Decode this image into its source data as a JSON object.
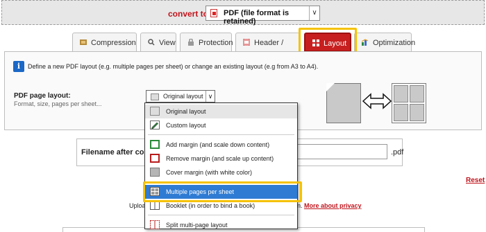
{
  "header": {
    "convert_label": "convert to:",
    "format_value": "PDF (file format is retained)"
  },
  "tabs": [
    {
      "label": "Compression",
      "icon": "compression-icon",
      "active": false
    },
    {
      "label": "View",
      "icon": "view-icon",
      "active": false
    },
    {
      "label": "Protection",
      "icon": "lock-icon",
      "active": false
    },
    {
      "label": "Header / footer",
      "icon": "header-footer-icon",
      "active": false
    },
    {
      "label": "Layout",
      "icon": "layout-icon",
      "active": true
    },
    {
      "label": "Optimization",
      "icon": "optimization-icon",
      "active": false
    }
  ],
  "panel": {
    "info_text": "Define a new PDF layout (e.g. multiple pages per sheet) or change an existing layout (e.g from A3 to A4).",
    "layout_label": "PDF page layout:",
    "layout_sub": "Format, size, pages per sheet...",
    "layout_select_value": "Original layout"
  },
  "dropdown": {
    "items": [
      {
        "label": "Original layout",
        "icon": "blank-page-icon"
      },
      {
        "label": "Custom layout",
        "icon": "pencil-icon"
      },
      {
        "label": "Add margin (and scale down content)",
        "icon": "add-margin-icon"
      },
      {
        "label": "Remove margin (and scale up content)",
        "icon": "remove-margin-icon"
      },
      {
        "label": "Cover margin (with white color)",
        "icon": "cover-margin-icon"
      },
      {
        "label": "Multiple pages per sheet",
        "icon": "multi-page-icon"
      },
      {
        "label": "Booklet (in order to bind a book)",
        "icon": "booklet-icon"
      },
      {
        "label": "Split multi-page layout",
        "icon": "split-icon"
      }
    ]
  },
  "filename": {
    "label": "Filename after conv",
    "extension": ".pdf"
  },
  "reset_label": "Reset",
  "upload_text": "Uploa",
  "privacy_prefix": "n.",
  "privacy_link": "More about privacy",
  "colors": {
    "accent": "#c71f1f",
    "highlight": "#f6c200",
    "hover": "#2f7bd3"
  }
}
